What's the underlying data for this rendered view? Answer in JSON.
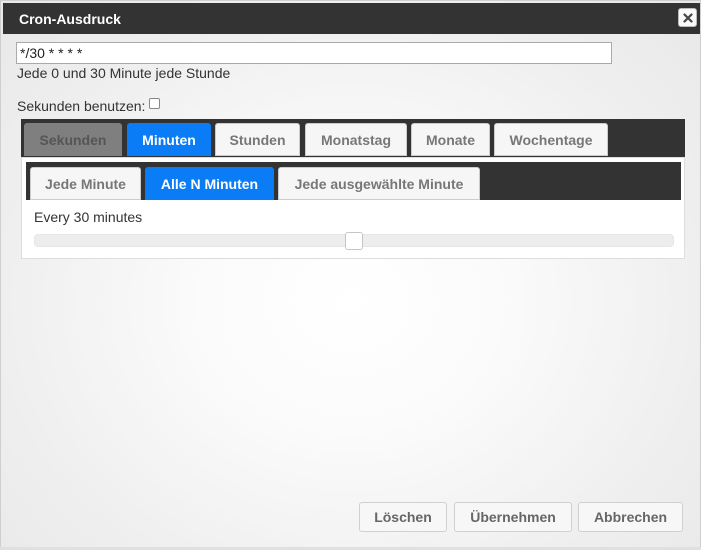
{
  "dialog": {
    "title": "Cron-Ausdruck",
    "close_icon": "close-icon"
  },
  "expression": {
    "value": "*/30 * * * *",
    "description": "Jede 0 und 30 Minute jede Stunde"
  },
  "seconds": {
    "label": "Sekunden benutzen:",
    "checked": false
  },
  "outer_tabs": [
    {
      "label": "Sekunden",
      "state": "disabled"
    },
    {
      "label": "Minuten",
      "state": "active"
    },
    {
      "label": "Stunden",
      "state": "normal"
    },
    {
      "label": "Monatstag",
      "state": "normal"
    },
    {
      "label": "Monate",
      "state": "normal"
    },
    {
      "label": "Wochentage",
      "state": "normal"
    }
  ],
  "inner_tabs": [
    {
      "label": "Jede Minute",
      "state": "normal"
    },
    {
      "label": "Alle N Minuten",
      "state": "active"
    },
    {
      "label": "Jede ausgewählte Minute",
      "state": "normal"
    }
  ],
  "slider": {
    "label": "Every 30 minutes",
    "value": 30,
    "min": 1,
    "max": 59
  },
  "buttons": {
    "clear": "Löschen",
    "apply": "Übernehmen",
    "cancel": "Abbrechen"
  },
  "colors": {
    "accent": "#0a7cf5",
    "titlebar": "#333333"
  }
}
